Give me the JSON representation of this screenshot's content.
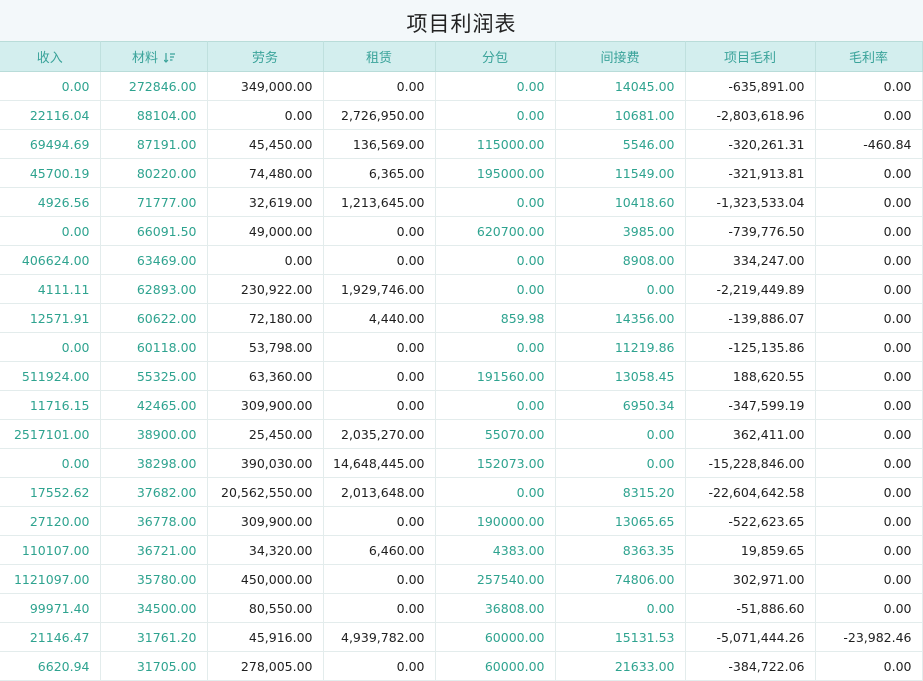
{
  "title": "项目利润表",
  "columns": [
    {
      "label": "收入",
      "sorted": false
    },
    {
      "label": "材料",
      "sorted": true
    },
    {
      "label": "劳务",
      "sorted": false
    },
    {
      "label": "租赁",
      "sorted": false
    },
    {
      "label": "分包",
      "sorted": false
    },
    {
      "label": "间接费",
      "sorted": false
    },
    {
      "label": "项目毛利",
      "sorted": false
    },
    {
      "label": "毛利率",
      "sorted": false
    }
  ],
  "column_colors": [
    "green",
    "green",
    "dark",
    "dark",
    "green",
    "green",
    "dark",
    "dark"
  ],
  "colors": {
    "accent": "#2ea38f",
    "header_bg": "#d3eeee",
    "header_text": "#3aa39a",
    "title_bg": "#f3f8fa"
  },
  "sort_icon": "sort-descending-icon",
  "rows": [
    [
      "0.00",
      "272846.00",
      "349,000.00",
      "0.00",
      "0.00",
      "14045.00",
      "-635,891.00",
      "0.00"
    ],
    [
      "22116.04",
      "88104.00",
      "0.00",
      "2,726,950.00",
      "0.00",
      "10681.00",
      "-2,803,618.96",
      "0.00"
    ],
    [
      "69494.69",
      "87191.00",
      "45,450.00",
      "136,569.00",
      "115000.00",
      "5546.00",
      "-320,261.31",
      "-460.84"
    ],
    [
      "45700.19",
      "80220.00",
      "74,480.00",
      "6,365.00",
      "195000.00",
      "11549.00",
      "-321,913.81",
      "0.00"
    ],
    [
      "4926.56",
      "71777.00",
      "32,619.00",
      "1,213,645.00",
      "0.00",
      "10418.60",
      "-1,323,533.04",
      "0.00"
    ],
    [
      "0.00",
      "66091.50",
      "49,000.00",
      "0.00",
      "620700.00",
      "3985.00",
      "-739,776.50",
      "0.00"
    ],
    [
      "406624.00",
      "63469.00",
      "0.00",
      "0.00",
      "0.00",
      "8908.00",
      "334,247.00",
      "0.00"
    ],
    [
      "4111.11",
      "62893.00",
      "230,922.00",
      "1,929,746.00",
      "0.00",
      "0.00",
      "-2,219,449.89",
      "0.00"
    ],
    [
      "12571.91",
      "60622.00",
      "72,180.00",
      "4,440.00",
      "859.98",
      "14356.00",
      "-139,886.07",
      "0.00"
    ],
    [
      "0.00",
      "60118.00",
      "53,798.00",
      "0.00",
      "0.00",
      "11219.86",
      "-125,135.86",
      "0.00"
    ],
    [
      "511924.00",
      "55325.00",
      "63,360.00",
      "0.00",
      "191560.00",
      "13058.45",
      "188,620.55",
      "0.00"
    ],
    [
      "11716.15",
      "42465.00",
      "309,900.00",
      "0.00",
      "0.00",
      "6950.34",
      "-347,599.19",
      "0.00"
    ],
    [
      "2517101.00",
      "38900.00",
      "25,450.00",
      "2,035,270.00",
      "55070.00",
      "0.00",
      "362,411.00",
      "0.00"
    ],
    [
      "0.00",
      "38298.00",
      "390,030.00",
      "14,648,445.00",
      "152073.00",
      "0.00",
      "-15,228,846.00",
      "0.00"
    ],
    [
      "17552.62",
      "37682.00",
      "20,562,550.00",
      "2,013,648.00",
      "0.00",
      "8315.20",
      "-22,604,642.58",
      "0.00"
    ],
    [
      "27120.00",
      "36778.00",
      "309,900.00",
      "0.00",
      "190000.00",
      "13065.65",
      "-522,623.65",
      "0.00"
    ],
    [
      "110107.00",
      "36721.00",
      "34,320.00",
      "6,460.00",
      "4383.00",
      "8363.35",
      "19,859.65",
      "0.00"
    ],
    [
      "1121097.00",
      "35780.00",
      "450,000.00",
      "0.00",
      "257540.00",
      "74806.00",
      "302,971.00",
      "0.00"
    ],
    [
      "99971.40",
      "34500.00",
      "80,550.00",
      "0.00",
      "36808.00",
      "0.00",
      "-51,886.60",
      "0.00"
    ],
    [
      "21146.47",
      "31761.20",
      "45,916.00",
      "4,939,782.00",
      "60000.00",
      "15131.53",
      "-5,071,444.26",
      "-23,982.46"
    ],
    [
      "6620.94",
      "31705.00",
      "278,005.00",
      "0.00",
      "60000.00",
      "21633.00",
      "-384,722.06",
      "0.00"
    ]
  ]
}
